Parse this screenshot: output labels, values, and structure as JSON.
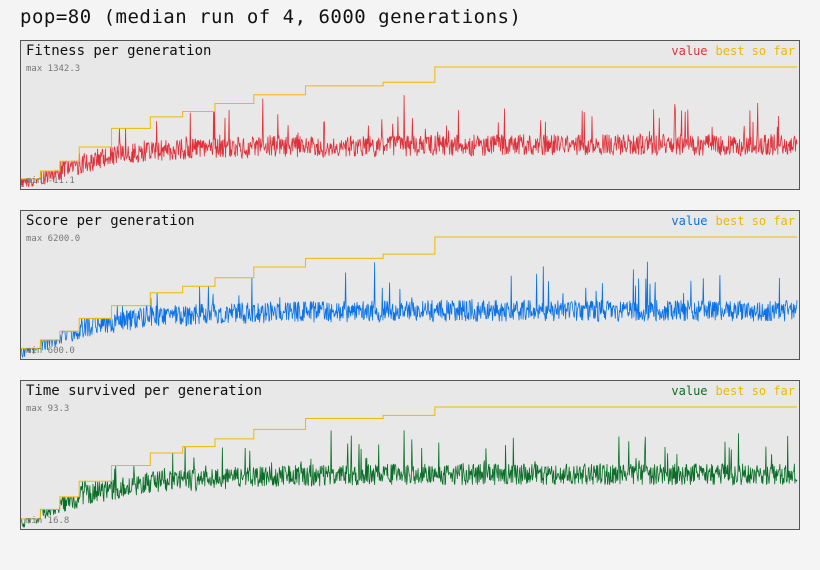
{
  "title": "pop=80 (median run of 4, 6000 generations)",
  "colors": {
    "background": "#f4f4f4",
    "panel_bg": "#e8e8e8",
    "best_so_far": "#f0b800"
  },
  "legend": {
    "value": "value",
    "best": "best so far"
  },
  "chart_data": [
    {
      "type": "line",
      "title": "Fitness per generation",
      "max_label": "max 1342.3",
      "min_label": "min -11.1",
      "ylim": [
        -11.1,
        1342.3
      ],
      "xlim": [
        0,
        6000
      ],
      "color": "#e0303a",
      "series": [
        {
          "name": "value",
          "y_baseline_by_x": [
            [
              0,
              50
            ],
            [
              200,
              120
            ],
            [
              500,
              250
            ],
            [
              1000,
              380
            ],
            [
              2000,
              420
            ],
            [
              3000,
              430
            ],
            [
              4000,
              440
            ],
            [
              5000,
              440
            ],
            [
              6000,
              440
            ]
          ]
        },
        {
          "name": "best so far",
          "steps": [
            [
              0,
              80
            ],
            [
              150,
              170
            ],
            [
              300,
              280
            ],
            [
              450,
              440
            ],
            [
              700,
              650
            ],
            [
              1000,
              780
            ],
            [
              1250,
              840
            ],
            [
              1500,
              930
            ],
            [
              1800,
              1030
            ],
            [
              2200,
              1130
            ],
            [
              2800,
              1170
            ],
            [
              3200,
              1342.3
            ],
            [
              6000,
              1342.3
            ]
          ]
        }
      ]
    },
    {
      "type": "line",
      "title": "Score per generation",
      "max_label": "max 6200.0",
      "min_label": "min 600.0",
      "ylim": [
        600.0,
        6200.0
      ],
      "xlim": [
        0,
        6000
      ],
      "color": "#0a72e6",
      "series": [
        {
          "name": "value",
          "y_baseline_by_x": [
            [
              0,
              900
            ],
            [
              200,
              1300
            ],
            [
              500,
              1900
            ],
            [
              1000,
              2400
            ],
            [
              2000,
              2600
            ],
            [
              3000,
              2650
            ],
            [
              4000,
              2650
            ],
            [
              5000,
              2650
            ],
            [
              6000,
              2650
            ]
          ]
        },
        {
          "name": "best so far",
          "steps": [
            [
              0,
              1000
            ],
            [
              150,
              1400
            ],
            [
              300,
              1800
            ],
            [
              450,
              2400
            ],
            [
              700,
              3000
            ],
            [
              1000,
              3600
            ],
            [
              1250,
              3900
            ],
            [
              1500,
              4300
            ],
            [
              1800,
              4800
            ],
            [
              2200,
              5200
            ],
            [
              2800,
              5400
            ],
            [
              3200,
              6200
            ],
            [
              6000,
              6200
            ]
          ]
        }
      ]
    },
    {
      "type": "line",
      "title": "Time survived per generation",
      "max_label": "max 93.3",
      "min_label": "min 16.8",
      "ylim": [
        16.8,
        93.3
      ],
      "xlim": [
        0,
        6000
      ],
      "color": "#0a6e28",
      "series": [
        {
          "name": "value",
          "y_baseline_by_x": [
            [
              0,
              20
            ],
            [
              200,
              28
            ],
            [
              500,
              36
            ],
            [
              1000,
              44
            ],
            [
              2000,
              48
            ],
            [
              3000,
              49
            ],
            [
              4000,
              49
            ],
            [
              5000,
              49
            ],
            [
              6000,
              49
            ]
          ]
        },
        {
          "name": "best so far",
          "steps": [
            [
              0,
              22
            ],
            [
              150,
              28
            ],
            [
              300,
              36
            ],
            [
              450,
              46
            ],
            [
              700,
              56
            ],
            [
              1000,
              64
            ],
            [
              1250,
              68
            ],
            [
              1500,
              73
            ],
            [
              1800,
              79
            ],
            [
              2200,
              86
            ],
            [
              2800,
              88
            ],
            [
              3200,
              93.3
            ],
            [
              6000,
              93.3
            ]
          ]
        }
      ]
    }
  ]
}
